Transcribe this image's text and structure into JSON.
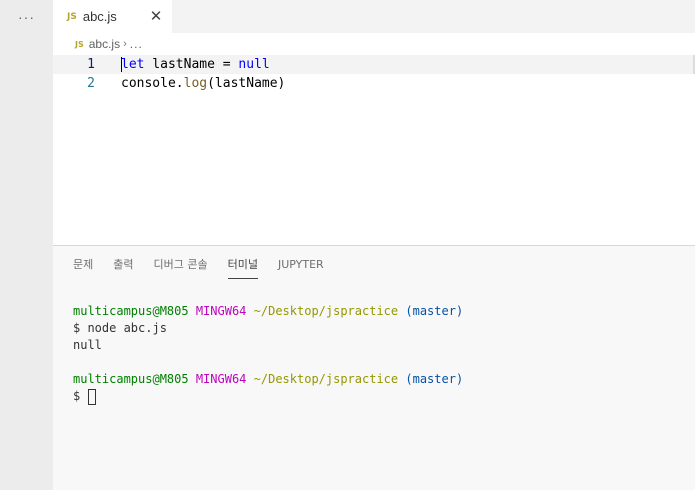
{
  "sidebar": {
    "more_label": "···"
  },
  "tab": {
    "icon_label": "JS",
    "name": "abc.js",
    "close_label": "✕"
  },
  "breadcrumb": {
    "icon_label": "JS",
    "file": "abc.js",
    "separator": "›",
    "more": "..."
  },
  "editor": {
    "lines": [
      {
        "number": "1",
        "tokens": [
          "let",
          " lastName ",
          "=",
          " null"
        ]
      },
      {
        "number": "2",
        "tokens": [
          "console.",
          "log",
          "(lastName)"
        ]
      }
    ]
  },
  "panel": {
    "tabs": [
      "문제",
      "출력",
      "디버그 콘솔",
      "터미널",
      "JUPYTER"
    ],
    "active_tab": "터미널"
  },
  "terminal": {
    "prompt1": {
      "user": "multicampus@M805",
      "msys": "MINGW64",
      "path": "~/Desktop/jspractice",
      "branch": "(master)"
    },
    "command": "$ node abc.js",
    "output": "null",
    "prompt2": {
      "user": "multicampus@M805",
      "msys": "MINGW64",
      "path": "~/Desktop/jspractice",
      "branch": "(master)"
    },
    "input_prompt": "$ "
  },
  "colors": {
    "keyword": "#0000ff",
    "function": "#795e26",
    "terminal_user": "#008000",
    "terminal_msys": "#bc05bc",
    "terminal_path": "#949800",
    "terminal_branch": "#0451a5"
  }
}
